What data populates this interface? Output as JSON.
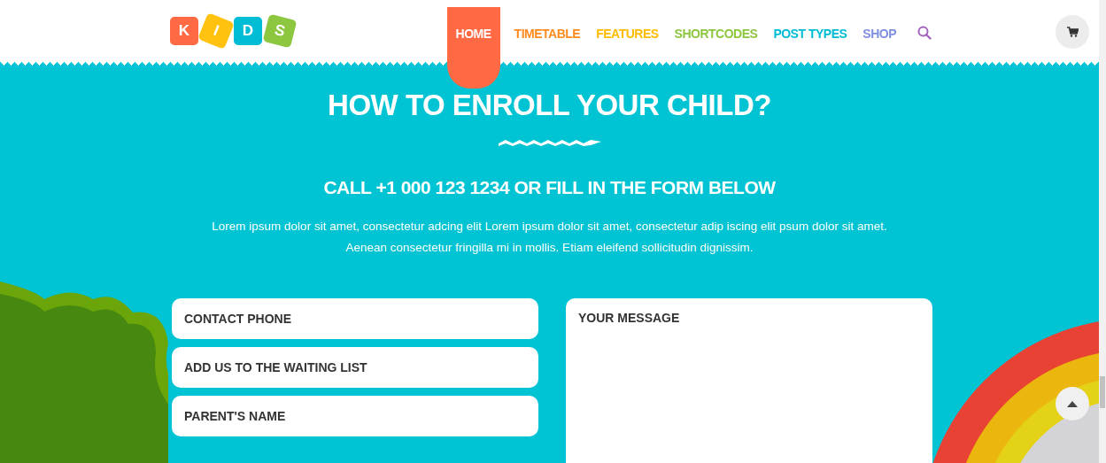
{
  "logo": {
    "letters": [
      {
        "char": "K",
        "color": "#ff6a45"
      },
      {
        "char": "I",
        "color": "#ffc20e"
      },
      {
        "char": "D",
        "color": "#00bcd4"
      },
      {
        "char": "S",
        "color": "#8dc63f"
      }
    ]
  },
  "nav": [
    {
      "label": "HOME",
      "selected": true,
      "color": "#ff6a45"
    },
    {
      "label": "TIMETABLE",
      "selected": false,
      "color": "#ff8a1e"
    },
    {
      "label": "FEATURES",
      "selected": false,
      "color": "#ffbb00"
    },
    {
      "label": "SHORTCODES",
      "selected": false,
      "color": "#8dc63f"
    },
    {
      "label": "POST TYPES",
      "selected": false,
      "color": "#00bcd4"
    },
    {
      "label": "SHOP",
      "selected": false,
      "color": "#7e8fe0"
    }
  ],
  "heading": "HOW TO ENROLL YOUR CHILD?",
  "subheading": "CALL +1 000 123 1234 OR FILL IN THE FORM BELOW",
  "intro": [
    "Lorem ipsum dolor sit amet, consectetur adcing elit Lorem ipsum dolor sit amet, consectetur adip iscing elit psum dolor sit amet.",
    "Aenean consectetur fringilla mi in mollis. Etiam eleifend sollicitudin dignissim."
  ],
  "form": {
    "fields": [
      {
        "placeholder": "CONTACT PHONE"
      },
      {
        "placeholder": "ADD US TO THE WAITING LIST"
      },
      {
        "placeholder": "PARENT'S NAME"
      }
    ],
    "message": {
      "placeholder": "YOUR MESSAGE"
    }
  }
}
